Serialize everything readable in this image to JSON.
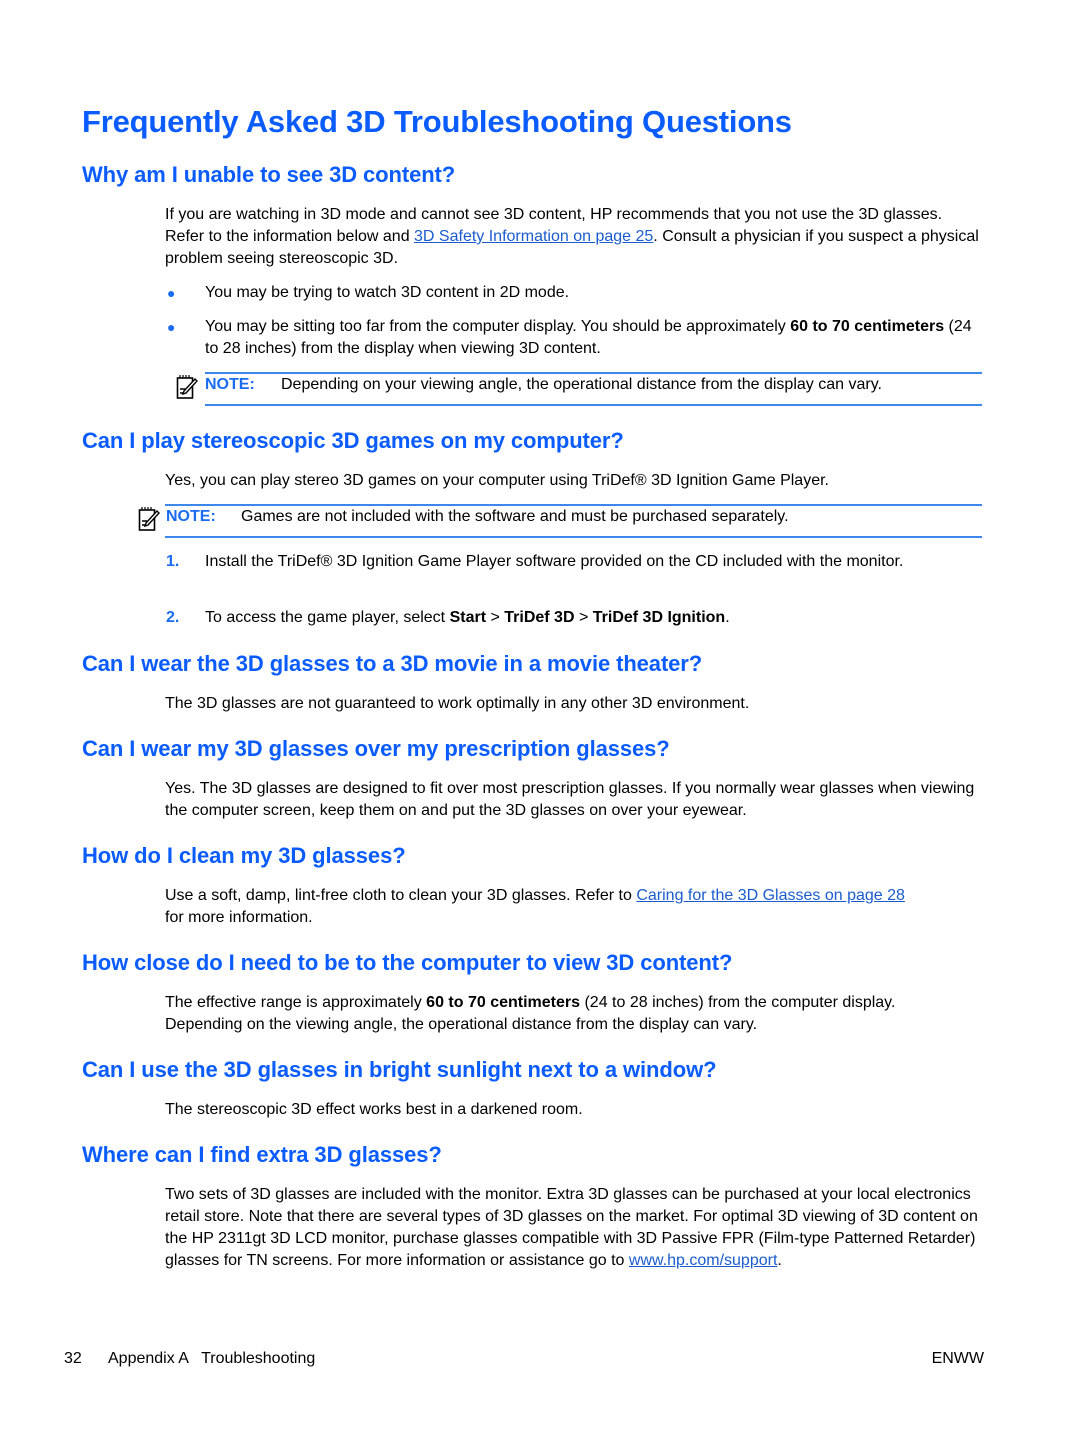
{
  "title": "Frequently Asked 3D Troubleshooting Questions",
  "sections": [
    {
      "heading": "Why am I unable to see 3D content?",
      "para": {
        "before": "If you are watching in 3D mode and cannot see 3D content, HP recommends that you not use the 3D glasses. Refer to the information below and ",
        "link": "3D Safety Information on page 25",
        "after": ". Consult a physician if you suspect a physical problem seeing stereoscopic 3D."
      },
      "bullets": [
        {
          "text": "You may be trying to watch 3D content in 2D mode."
        },
        {
          "before": "You may be sitting too far from the computer display. You should be approximately ",
          "bold": "60 to 70 centimeters",
          "after": " (24 to 28 inches) from the display when viewing 3D content."
        }
      ],
      "note": {
        "label": "NOTE:",
        "text": "Depending on your viewing angle, the operational distance from the display can vary."
      }
    },
    {
      "heading": "Can I play stereoscopic 3D games on my computer?",
      "para": "Yes, you can play stereo 3D games on your computer using TriDef® 3D Ignition Game Player.",
      "note": {
        "label": "NOTE:",
        "text": "Games are not included with the software and must be purchased separately."
      },
      "steps": [
        {
          "number": "1.",
          "text": "Install the TriDef® 3D Ignition Game Player software provided on the CD included with the monitor."
        },
        {
          "number": "2.",
          "before": "To access the game player, select ",
          "b1": "Start",
          "sep1": " > ",
          "b2": "TriDef 3D",
          "sep2": " > ",
          "b3": "TriDef 3D Ignition",
          "after": "."
        }
      ]
    },
    {
      "heading": "Can I wear the 3D glasses to a 3D movie in a movie theater?",
      "para": "The 3D glasses are not guaranteed to work optimally in any other 3D environment."
    },
    {
      "heading": "Can I wear my 3D glasses over my prescription glasses?",
      "para": "Yes. The 3D glasses are designed to fit over most prescription glasses. If you normally wear glasses when viewing the computer screen, keep them on and put the 3D glasses on over your eyewear."
    },
    {
      "heading": "How do I clean my 3D glasses?",
      "para": {
        "before": "Use a soft, damp, lint-free cloth to clean your 3D glasses. Refer to ",
        "link": "Caring for the 3D Glasses on page 28",
        "after": " for more information."
      }
    },
    {
      "heading": "How close do I need to be to the computer to view 3D content?",
      "para": {
        "before": "The effective range is approximately ",
        "bold": "60 to 70 centimeters",
        "after": " (24 to 28 inches) from the computer display. Depending on the viewing angle, the operational distance from the display can vary."
      }
    },
    {
      "heading": "Can I use the 3D glasses in bright sunlight next to a window?",
      "para": "The stereoscopic 3D effect works best in a darkened room."
    },
    {
      "heading": "Where can I find extra 3D glasses?",
      "para": {
        "before": "Two sets of 3D glasses are included with the monitor. Extra 3D glasses can be purchased at your local electronics retail store. Note that there are several types of 3D glasses on the market. For optimal 3D viewing of 3D content on the HP 2311gt 3D LCD monitor, purchase glasses compatible with 3D Passive FPR (Film-type Patterned Retarder) glasses for TN screens. For more information or assistance go to ",
        "link": "www.hp.com/support",
        "after": "."
      }
    }
  ],
  "footer": {
    "page_number": "32",
    "section": "Appendix A   Troubleshooting",
    "code": "ENWW"
  },
  "icons": {
    "bullet": "●",
    "note": "note-pencil-icon"
  },
  "colors": {
    "heading": "#0a5cff",
    "link": "#1a5ccf",
    "rule": "#3d86ea"
  }
}
